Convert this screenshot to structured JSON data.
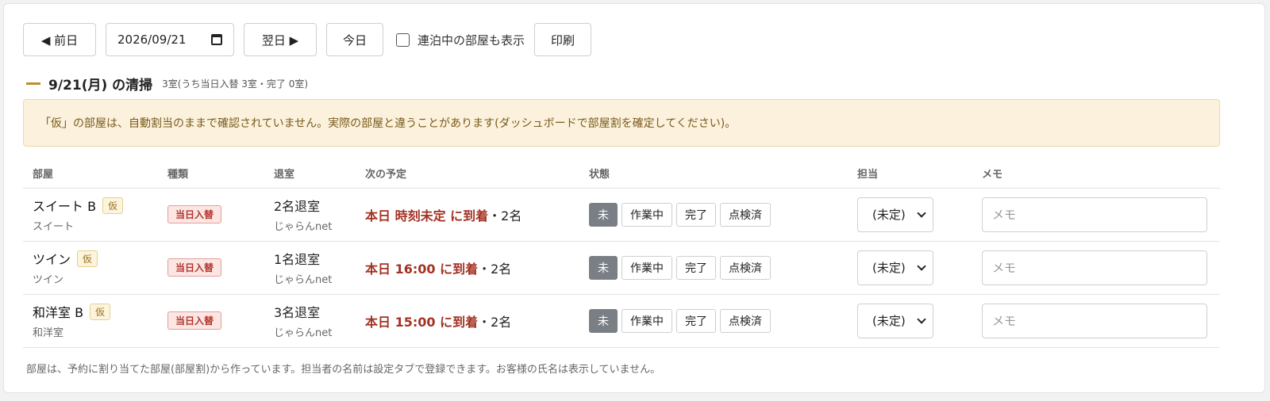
{
  "toolbar": {
    "prev_label": "◀ 前日",
    "date_value": "2026/09/21",
    "next_label": "翌日 ▶",
    "today_label": "今日",
    "show_continuing_label": "連泊中の部屋も表示",
    "print_label": "印刷"
  },
  "section": {
    "title": "9/21(月) の清掃",
    "summary": "3室(うち当日入替 3室・完了 0室)"
  },
  "notice": "「仮」の部屋は、自動割当のままで確認されていません。実際の部屋と違うことがあります(ダッシュボードで部屋割を確定してください)。",
  "table": {
    "headers": [
      "部屋",
      "種類",
      "退室",
      "次の予定",
      "状態",
      "担当",
      "メモ"
    ],
    "status_labels": [
      "未",
      "作業中",
      "完了",
      "点検済"
    ],
    "rows": [
      {
        "room": "スイート B",
        "kari": "仮",
        "room_type": "スイート",
        "type_tag": "当日入替",
        "checkout": "2名退室",
        "source": "じゃらんnet",
        "next_red": "本日 時刻未定 に到着",
        "next_rest": "・2名",
        "staff": "(未定)",
        "memo_placeholder": "メモ"
      },
      {
        "room": "ツイン",
        "kari": "仮",
        "room_type": "ツイン",
        "type_tag": "当日入替",
        "checkout": "1名退室",
        "source": "じゃらんnet",
        "next_red": "本日 16:00 に到着",
        "next_rest": "・2名",
        "staff": "(未定)",
        "memo_placeholder": "メモ"
      },
      {
        "room": "和洋室 B",
        "kari": "仮",
        "room_type": "和洋室",
        "type_tag": "当日入替",
        "checkout": "3名退室",
        "source": "じゃらんnet",
        "next_red": "本日 15:00 に到着",
        "next_rest": "・2名",
        "staff": "(未定)",
        "memo_placeholder": "メモ"
      }
    ]
  },
  "footnote": "部屋は、予約に割り当てた部屋(部屋割)から作っています。担当者の名前は設定タブで登録できます。お客様の氏名は表示していません。",
  "colors": {
    "accent": "#b8902f",
    "arrival_red": "#a33223",
    "active_status": "#7a7f86",
    "notice_bg": "#fbf1dc"
  }
}
